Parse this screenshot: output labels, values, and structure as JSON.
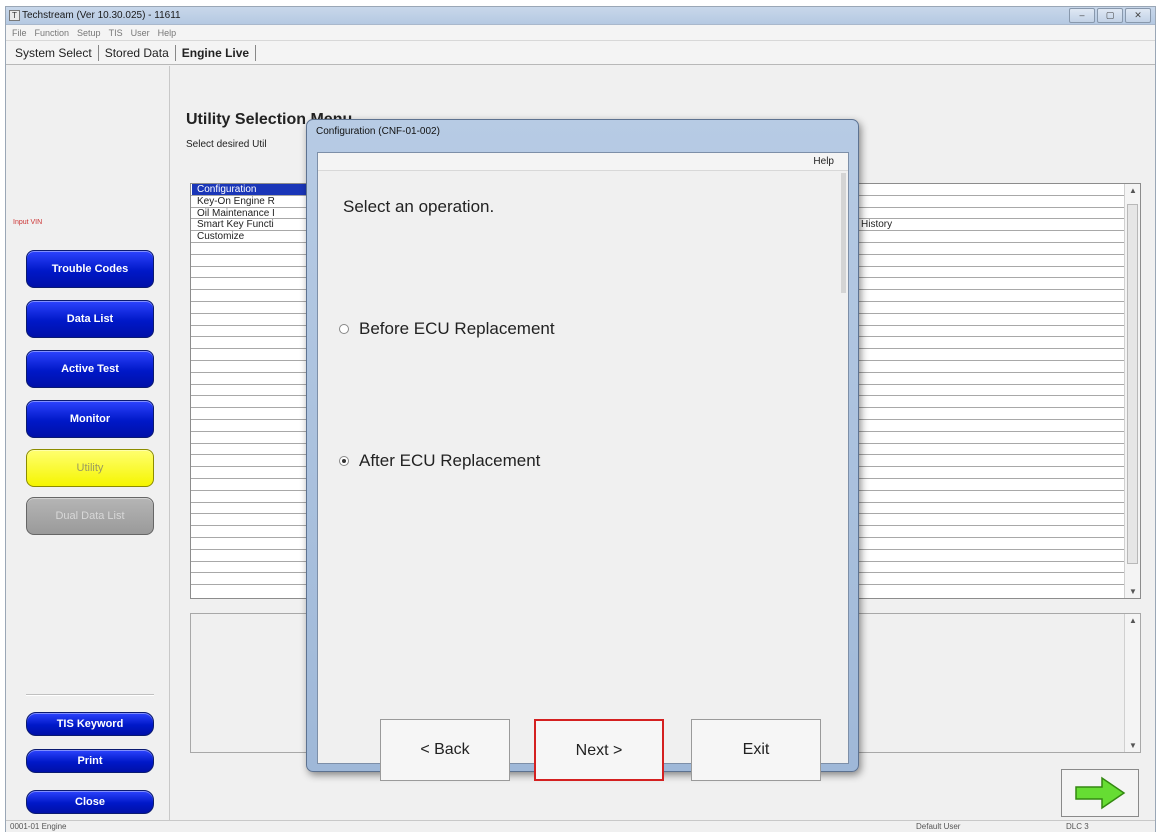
{
  "window": {
    "title": "Techstream (Ver 10.30.025) - 11611",
    "controls": [
      "–",
      "▢",
      "✕"
    ]
  },
  "menu": [
    "File",
    "Function",
    "Setup",
    "TIS",
    "User",
    "Help"
  ],
  "tabs": [
    {
      "label": "System Select"
    },
    {
      "label": "Stored Data"
    },
    {
      "label": "Engine Live"
    }
  ],
  "sidebar": {
    "input_vin": "Input VIN",
    "buttons": {
      "trouble_codes": "Trouble Codes",
      "data_list": "Data List",
      "active_test": "Active Test",
      "monitor": "Monitor",
      "utility": "Utility",
      "dual_data_list": "Dual Data List",
      "tis_keyword": "TIS Keyword",
      "print": "Print",
      "close": "Close"
    }
  },
  "main": {
    "title": "Utility Selection Menu",
    "subtitle": "Select desired Util",
    "list": [
      {
        "label": "Configuration",
        "extra": "",
        "selected": true
      },
      {
        "label": "Key-On Engine R",
        "extra": ""
      },
      {
        "label": "Oil Maintenance I",
        "extra": ""
      },
      {
        "label": "Smart Key Functi",
        "extra": "History"
      },
      {
        "label": "Customize",
        "extra": ""
      }
    ]
  },
  "dialog": {
    "title": "Configuration (CNF-01-002)",
    "help": "Help",
    "prompt": "Select an operation.",
    "options": [
      {
        "label": "Before ECU Replacement",
        "selected": false
      },
      {
        "label": "After ECU Replacement",
        "selected": true
      }
    ],
    "back_label": "< Back",
    "next_label": "Next >",
    "exit_label": "Exit"
  },
  "statusbar": {
    "left": "0001-01 Engine",
    "right1": "Default User",
    "right2": "DLC 3"
  },
  "colors": {
    "accent_blue": "#0018c8",
    "utility_yellow": "#f5f500",
    "highlight": "#d42020"
  }
}
